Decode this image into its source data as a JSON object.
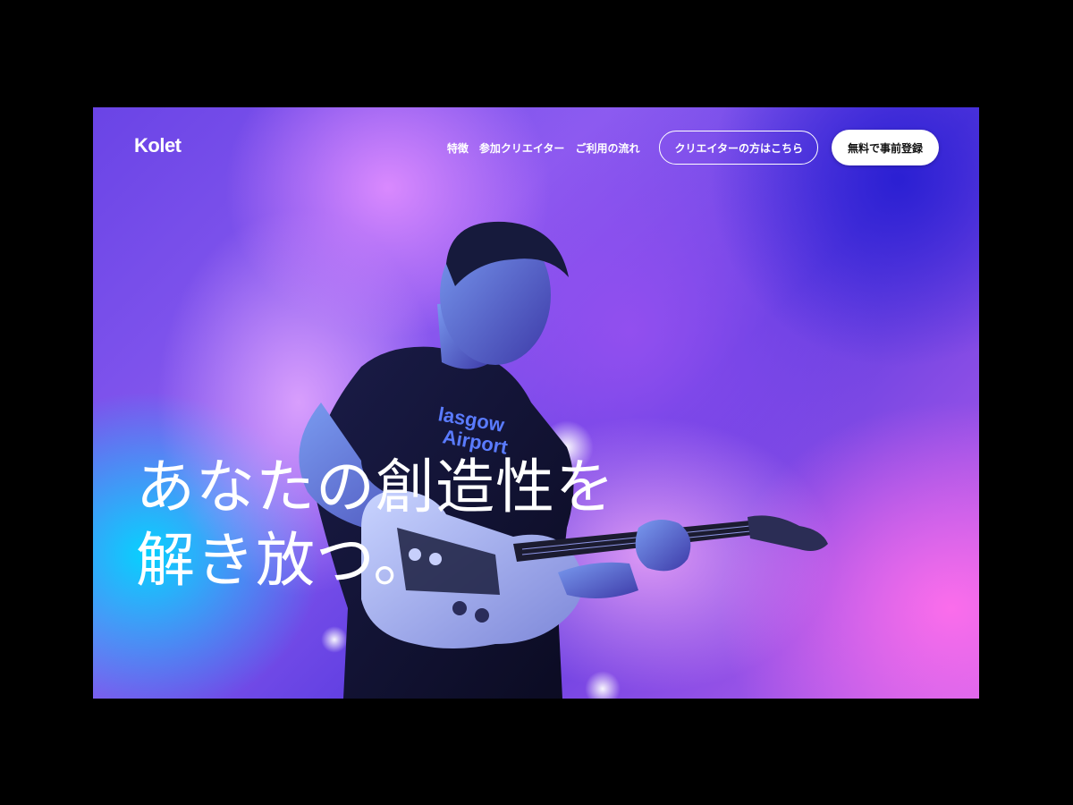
{
  "brand": {
    "logo_text": "Kolet"
  },
  "nav": {
    "links": [
      {
        "label": "特徴"
      },
      {
        "label": "参加クリエイター"
      },
      {
        "label": "ご利用の流れ"
      }
    ],
    "creator_button_label": "クリエイターの方はこちら",
    "register_button_label": "無料で事前登録"
  },
  "hero": {
    "headline_line1": "あなたの創造性を",
    "headline_line2": "解き放つ。",
    "image_description_icon": "guitarist-photo"
  },
  "colors": {
    "page_background": "#000000",
    "text": "#ffffff",
    "button_solid_bg": "#ffffff",
    "button_solid_text": "#111111",
    "accent_purple": "#8b5cf0",
    "accent_cyan": "#00d7ff",
    "accent_pink": "#ff6eeb"
  }
}
